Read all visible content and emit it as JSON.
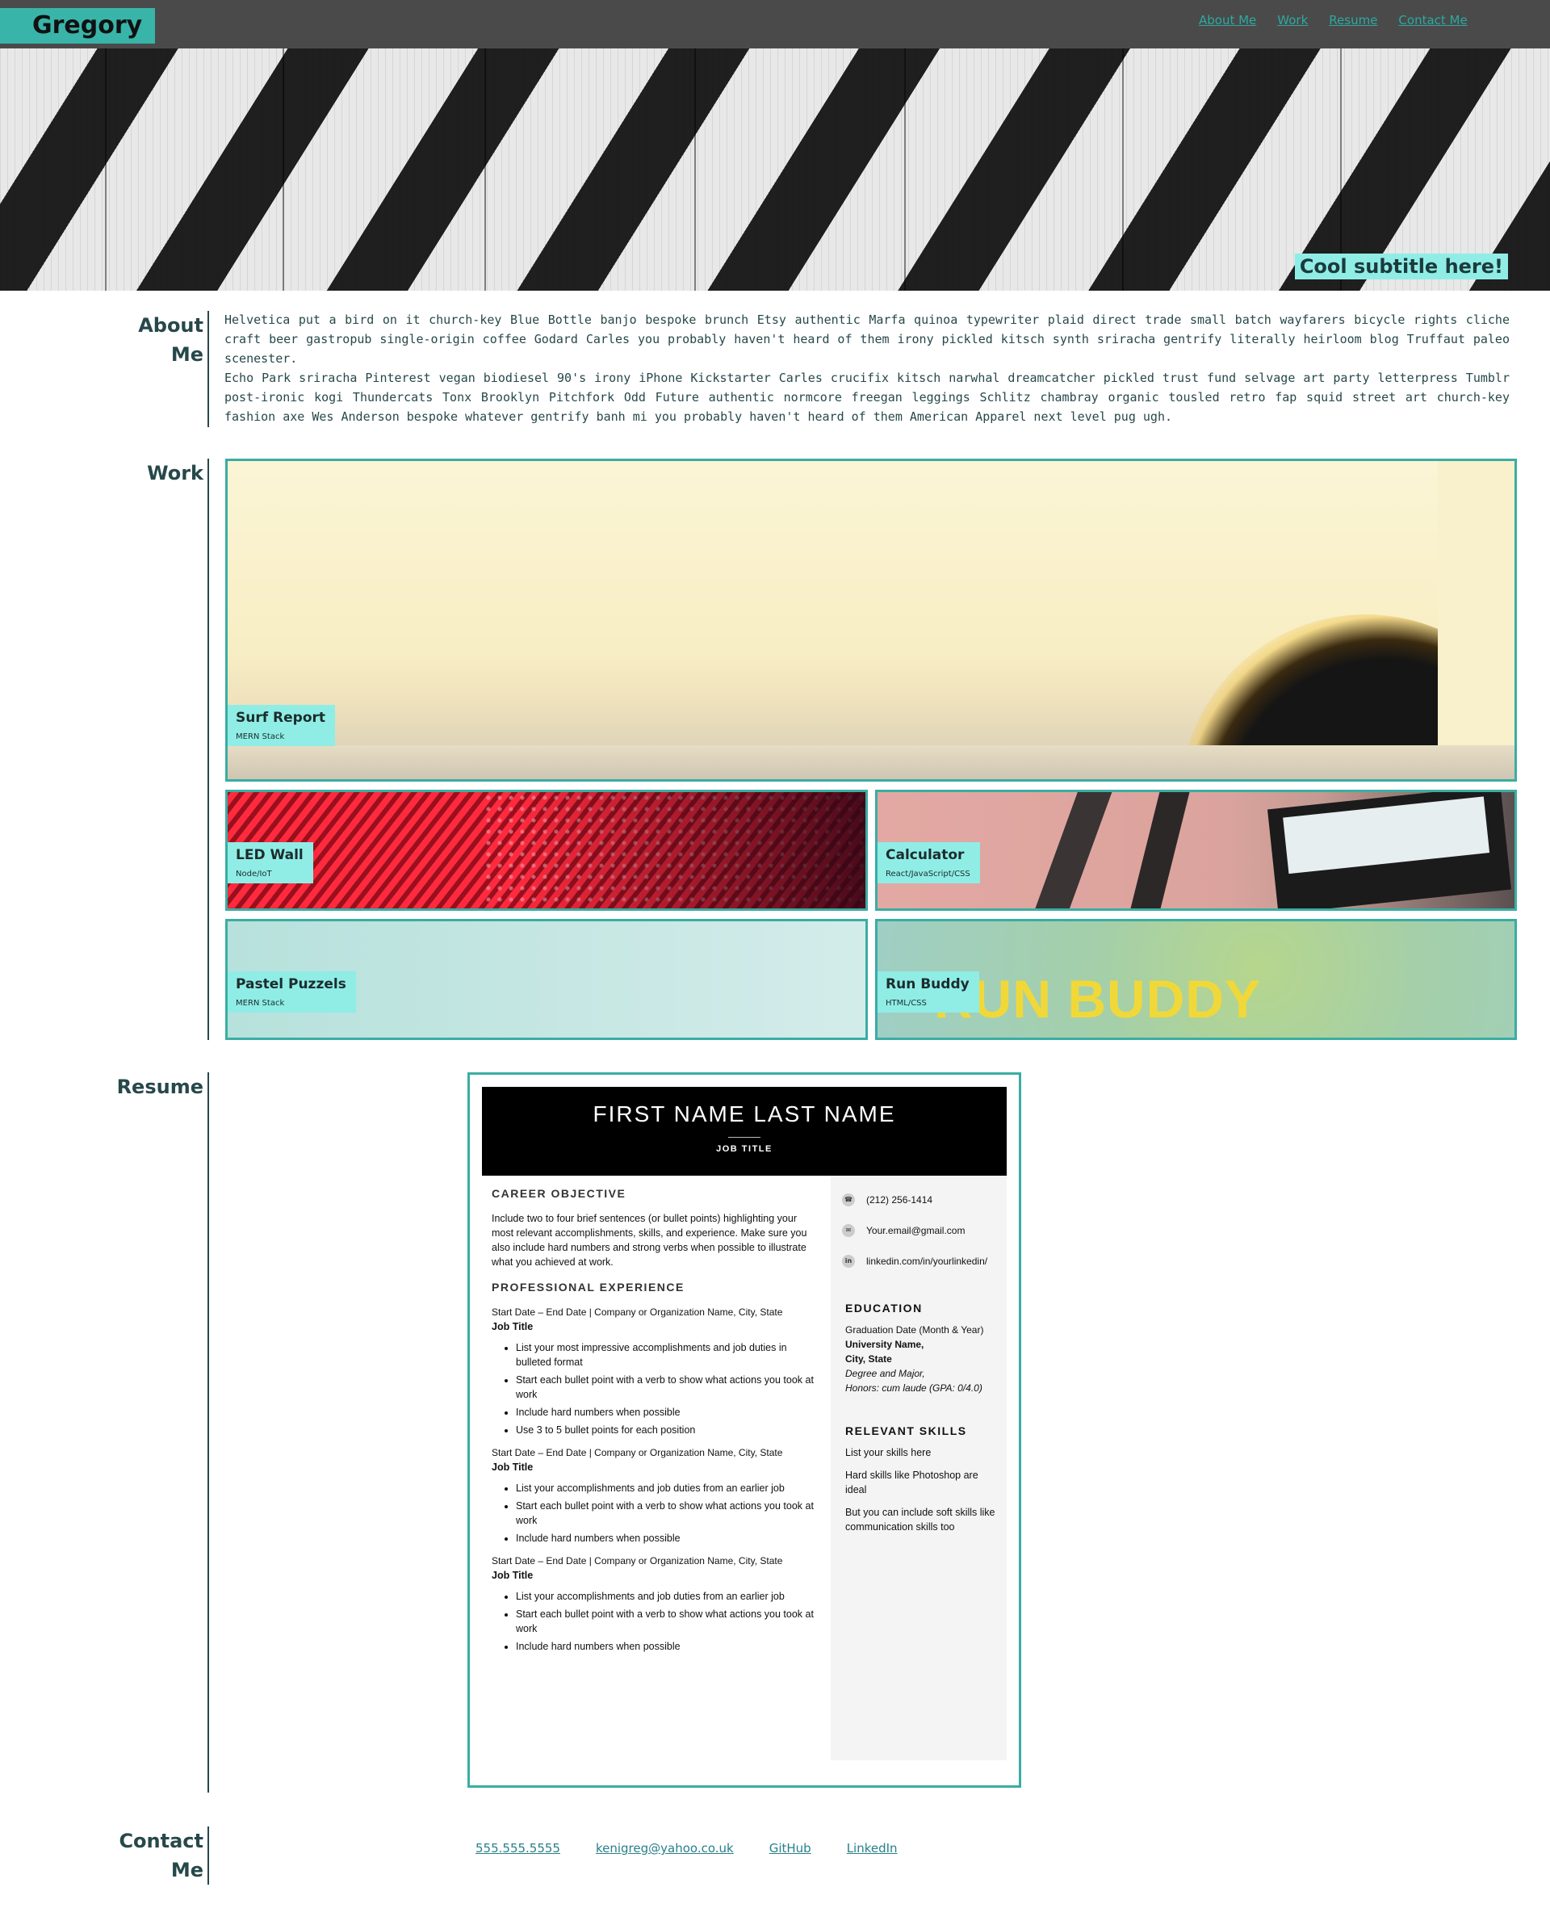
{
  "header": {
    "brand": "Gregory",
    "nav": [
      "About Me",
      "Work",
      "Resume",
      "Contact Me"
    ]
  },
  "hero": {
    "subtitle": "Cool subtitle here!"
  },
  "about": {
    "label_line1": "About",
    "label_line2": "Me",
    "p1": "Helvetica put a bird on it church-key Blue Bottle banjo bespoke brunch Etsy authentic Marfa quinoa typewriter plaid direct trade small batch wayfarers bicycle rights cliche craft beer gastropub single-origin coffee Godard Carles you probably haven't heard of them irony pickled kitsch synth sriracha gentrify literally heirloom blog Truffaut paleo scenester.",
    "p2": "Echo Park sriracha Pinterest vegan biodiesel 90's irony iPhone Kickstarter Carles crucifix kitsch narwhal dreamcatcher pickled trust fund selvage art party letterpress Tumblr post-ironic kogi Thundercats Tonx Brooklyn Pitchfork Odd Future authentic normcore freegan leggings Schlitz chambray organic tousled retro fap squid street art church-key fashion axe Wes Anderson bespoke whatever gentrify banh mi you probably haven't heard of them American Apparel next level pug ugh."
  },
  "work": {
    "label": "Work",
    "projects": [
      {
        "title": "Surf Report",
        "stack": "MERN Stack"
      },
      {
        "title": "LED Wall",
        "stack": "Node/IoT"
      },
      {
        "title": "Calculator",
        "stack": "React/JavaScript/CSS"
      },
      {
        "title": "Pastel Puzzels",
        "stack": "MERN Stack"
      },
      {
        "title": "Run Buddy",
        "stack": "HTML/CSS",
        "image_text": "RUN BUDDY"
      }
    ]
  },
  "resume": {
    "label": "Resume",
    "name": "FIRST NAME LAST NAME",
    "job_title": "JOB TITLE",
    "objective_heading": "CAREER OBJECTIVE",
    "objective": "Include two to four brief sentences (or bullet points) highlighting your most relevant accomplishments, skills, and experience. Make sure you also include hard numbers and strong verbs when possible to illustrate what you achieved at work.",
    "experience_heading": "PROFESSIONAL EXPERIENCE",
    "jobs": [
      {
        "dates": "Start Date – End Date | Company or Organization Name, City, State",
        "title": "Job Title",
        "bullets": [
          "List your most impressive accomplishments and job duties in bulleted format",
          "Start each bullet point with a verb to show what actions you took at work",
          "Include hard numbers when possible",
          "Use 3 to 5 bullet points for each position"
        ]
      },
      {
        "dates": "Start Date – End Date | Company or Organization Name, City, State",
        "title": "Job Title",
        "bullets": [
          "List your accomplishments and job duties from an earlier job",
          "Start each bullet point with a verb to show what actions you took at work",
          "Include hard numbers when possible"
        ]
      },
      {
        "dates": "Start Date – End Date | Company or Organization Name, City, State",
        "title": "Job Title",
        "bullets": [
          "List your accomplishments and job duties from an earlier job",
          "Start each bullet point with a verb to show what actions you took at work",
          "Include hard numbers when possible"
        ]
      }
    ],
    "contact": {
      "phone": "(212) 256-1414",
      "email": "Your.email@gmail.com",
      "linkedin": "linkedin.com/in/yourlinkedin/"
    },
    "education_heading": "EDUCATION",
    "education": {
      "grad": "Graduation Date (Month & Year)",
      "university": "University Name,",
      "city": "City, State",
      "degree": "Degree and Major,",
      "honors": "Honors: cum laude (GPA: 0/4.0)"
    },
    "skills_heading": "RELEVANT SKILLS",
    "skills": [
      "List your skills here",
      "Hard skills like Photoshop are ideal",
      "But you can include soft skills like communication skills too"
    ]
  },
  "contact": {
    "label_line1": "Contact",
    "label_line2": "Me",
    "links": [
      "555.555.5555",
      "kenigreg@yahoo.co.uk",
      "GitHub",
      "LinkedIn"
    ]
  },
  "colors": {
    "accent": "#39b4a9",
    "tag_bg": "#8fede6",
    "header_bg": "#4a4a4a",
    "text": "#27484a"
  },
  "icons": [
    "phone-icon",
    "email-icon",
    "linkedin-icon"
  ]
}
